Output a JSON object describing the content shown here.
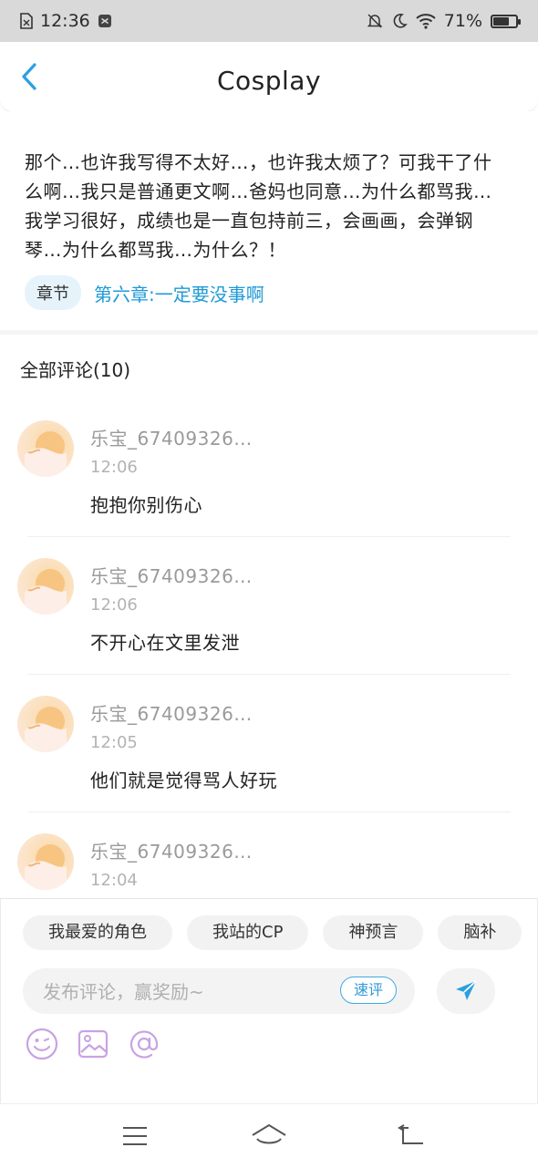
{
  "status_bar": {
    "time": "12:36",
    "battery": "71%",
    "battery_level": 0.71
  },
  "header": {
    "title": "Cosplay",
    "back_icon": "chevron-left-icon"
  },
  "post": {
    "text": "那个…也许我写得不太好…，也许我太烦了？可我干了什么啊…我只是普通更文啊…爸妈也同意…为什么都骂我…我学习很好，成绩也是一直包持前三，会画画，会弹钢琴…为什么都骂我…为什么？！",
    "chapter_tag": "章节",
    "chapter_title": "第六章:一定要没事啊"
  },
  "comments_section": {
    "title": "全部评论(10)",
    "items": [
      {
        "name": "乐宝_67409326…",
        "time": "12:06",
        "text": "抱抱你别伤心"
      },
      {
        "name": "乐宝_67409326…",
        "time": "12:06",
        "text": "不开心在文里发泄"
      },
      {
        "name": "乐宝_67409326…",
        "time": "12:05",
        "text": "他们就是觉得骂人好玩"
      },
      {
        "name": "乐宝_67409326…",
        "time": "12:04",
        "text": ""
      }
    ]
  },
  "composer": {
    "chips": [
      "我最爱的角色",
      "我站的CP",
      "神预言",
      "脑补"
    ],
    "placeholder": "发布评论，赢奖励~",
    "quick_review": "速评",
    "send_icon": "send-icon",
    "tools": [
      "emoji-icon",
      "image-icon",
      "mention-icon"
    ]
  },
  "colors": {
    "accent": "#1f9ad6",
    "tool_purple": "#c9a2e4",
    "status_bar_bg": "#d9d9d9"
  },
  "nav_bar": {
    "icons": [
      "menu-icon",
      "home-icon",
      "back-icon"
    ]
  }
}
